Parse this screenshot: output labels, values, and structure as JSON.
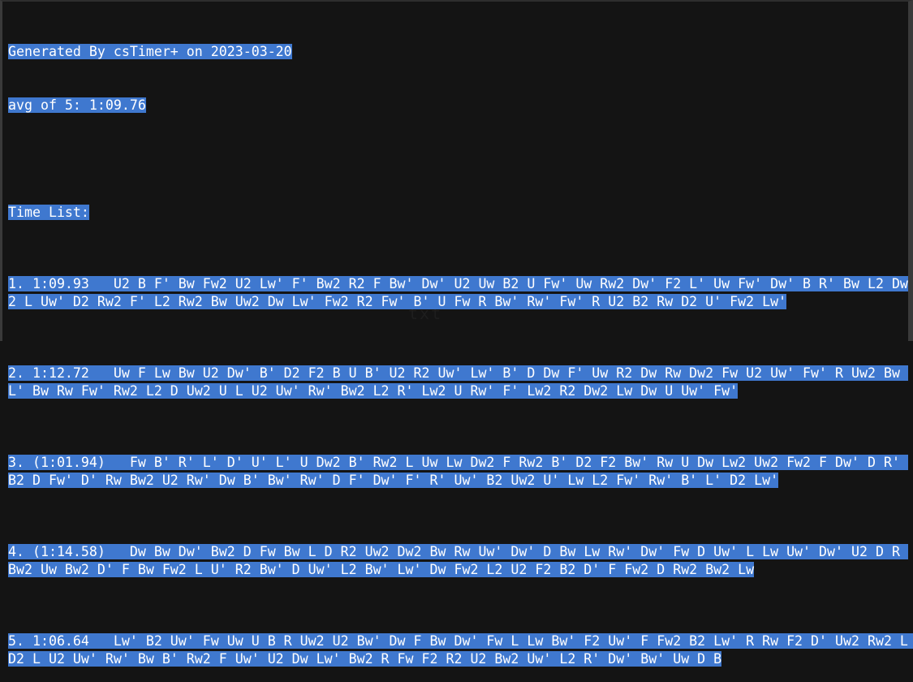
{
  "header": {
    "generated_by": "Generated By csTimer+ on 2023-03-20",
    "average": "avg of 5: 1:09.76"
  },
  "time_list": {
    "title": "Time List:",
    "solves": [
      {
        "label": "1. 1:09.93   ",
        "scramble": "U2 B F' Bw Fw2 U2 Lw' F' Bw2 R2 F Bw' Dw' U2 Uw B2 U Fw' Uw Rw2 Dw' F2 L' Uw Fw' Dw' B R' Bw L2 Dw2 L Uw' D2 Rw2 F' L2 Rw2 Bw Uw2 Dw Lw' Fw2 R2 Fw' B' U Fw R Bw' Rw' Fw' R U2 B2 Rw D2 U' Fw2 Lw'"
      },
      {
        "label": "2. 1:12.72   ",
        "scramble": "Uw F Lw Bw U2 Dw' B' D2 F2 B U B' U2 R2 Uw' Lw' B' D Dw F' Uw R2 Dw Rw Dw2 Fw U2 Uw' Fw' R Uw2 Bw L' Bw Rw Fw' Rw2 L2 D Uw2 U L U2 Uw' Rw' Bw2 L2 R' Lw2 U Rw' F' Lw2 R2 Dw2 Lw Dw U Uw' Fw'"
      },
      {
        "label": "3. (1:01.94)   ",
        "scramble": "Fw B' R' L' D' U' L' U Dw2 B' Rw2 L Uw Lw Dw2 F Rw2 B' D2 F2 Bw' Rw U Dw Lw2 Uw2 Fw2 F Dw' D R' B2 D Fw' D' Rw Bw2 U2 Rw' Dw B' Bw' Rw' D F' Dw' F' R' Uw' B2 Uw2 U' Lw L2 Fw' Rw' B' L' D2 Lw'"
      },
      {
        "label": "4. (1:14.58)   ",
        "scramble": "Dw Bw Dw' Bw2 D Fw Bw L D R2 Uw2 Dw2 Bw Rw Uw' Dw' D Bw Lw Rw' Dw' Fw D Uw' L Lw Uw' Dw' U2 D R Bw2 Uw Bw2 D' F Bw Fw2 L U' R2 Bw' D Uw' L2 Bw' Lw' Dw Fw2 L2 U2 F2 B2 D' F Fw2 D Rw2 Bw2 Lw"
      },
      {
        "label": "5. 1:06.64   ",
        "scramble": "Lw' B2 Uw' Fw Uw U B R Uw2 U2 Bw' Dw F Bw Dw' Fw L Lw Bw' F2 Uw' F Fw2 B2 Lw' R Rw F2 D' Uw2 Rw2 L D2 L U2 Uw' Rw' Bw B' Rw2 F Uw' U2 Dw Lw' Bw2 R Fw F2 R2 U2 Bw2 Uw' L2 R' Dw' Bw' Uw D B"
      }
    ]
  },
  "ghost_text": "txt"
}
